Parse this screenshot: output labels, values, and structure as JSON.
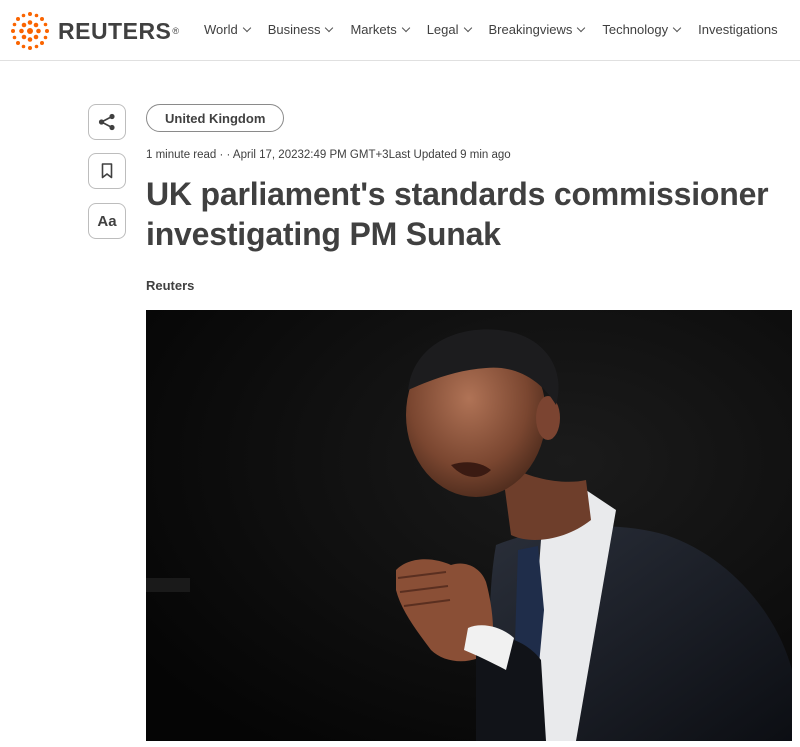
{
  "header": {
    "brand": "REUTERS",
    "brand_mark": "®",
    "nav": [
      {
        "label": "World",
        "has_dropdown": true
      },
      {
        "label": "Business",
        "has_dropdown": true
      },
      {
        "label": "Markets",
        "has_dropdown": true
      },
      {
        "label": "Legal",
        "has_dropdown": true
      },
      {
        "label": "Breakingviews",
        "has_dropdown": true
      },
      {
        "label": "Technology",
        "has_dropdown": true
      },
      {
        "label": "Investigations",
        "has_dropdown": false
      }
    ]
  },
  "tools": {
    "share_icon": "share-icon",
    "bookmark_icon": "bookmark-icon",
    "font_size_label": "Aa"
  },
  "article": {
    "section_tag": "United Kingdom",
    "meta": "1 minute read · · April 17, 20232:49 PM GMT+3Last Updated 9 min ago",
    "headline": "UK parliament's standards commissioner investigating PM Sunak",
    "byline": "Reuters"
  },
  "colors": {
    "brand_orange": "#fa6400",
    "text": "#404040",
    "border": "#bdbdbd"
  }
}
